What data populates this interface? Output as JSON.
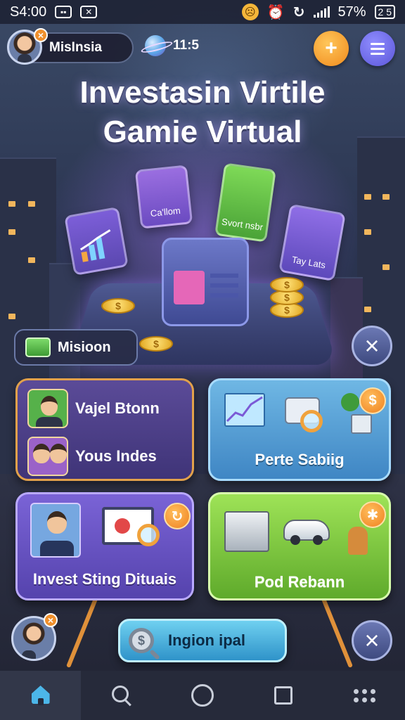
{
  "status_bar": {
    "time": "S4:00",
    "battery_percent": "57%",
    "battery_label": "2 5"
  },
  "profile": {
    "name": "MisInsia",
    "badge": "×"
  },
  "currency": {
    "amount": "11:5"
  },
  "header_buttons": {
    "add_symbol": "+"
  },
  "title": {
    "line1": "Investasin Virtile",
    "line2": "Gamie Virtual"
  },
  "hero_cards": {
    "callom": "Ca'llom",
    "sport": "Svort nsbr",
    "tay": "Tay Lats"
  },
  "mission": {
    "label": "Misioon"
  },
  "tiles": {
    "people": {
      "row1": "Vajel Btonn",
      "row2": "Yous Indes"
    },
    "perte": {
      "label": "Perte Sabiig",
      "badge": "$"
    },
    "invest": {
      "label": "Invest Sting Dituais",
      "badge": "↻"
    },
    "pod": {
      "label": "Pod Rebann",
      "badge": "✱"
    }
  },
  "search_button": {
    "label": "Ingion ipal",
    "coin_symbol": "$"
  },
  "close_symbol": "×",
  "coin_symbol": "$",
  "accent_colors": {
    "orange": "#f08a1c",
    "purple": "#5b56d8",
    "green": "#5faa2b",
    "blue": "#3f86c4"
  },
  "nav": {
    "items": [
      "home-icon",
      "search-icon",
      "circle-icon",
      "square-icon",
      "apps-grid-icon"
    ],
    "active": "home-icon"
  }
}
